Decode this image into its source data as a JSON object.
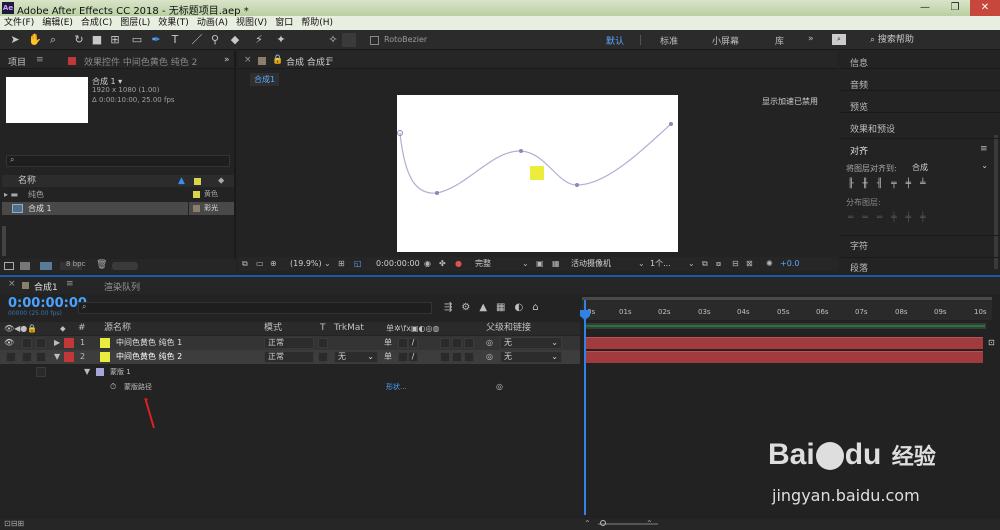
{
  "window": {
    "title": "Adobe After Effects CC 2018 - 无标题项目.aep *",
    "logo": "Ae"
  },
  "menu": [
    "文件(F)",
    "编辑(E)",
    "合成(C)",
    "图层(L)",
    "效果(T)",
    "动画(A)",
    "视图(V)",
    "窗口",
    "帮助(H)"
  ],
  "toolbar": {
    "rotobezier": "RotoBezier",
    "workspaces": [
      "默认",
      "标准",
      "小屏幕",
      "库"
    ],
    "search_placeholder": "搜索帮助"
  },
  "project": {
    "tab_label": "项目",
    "effects_tab": "效果控件 中间色黄色 纯色 2",
    "comp_name": "合成 1 ▾",
    "comp_res": "1920 x 1080 (1.00)",
    "comp_duration": "Δ 0:00:10:00, 25.00 fps",
    "col_name": "名称",
    "items": [
      {
        "name": "纯色",
        "type": "黄色"
      },
      {
        "name": "合成 1",
        "type": "彩光"
      }
    ],
    "bpc": "8 bpc"
  },
  "comp": {
    "tab_label": "合成 合成1",
    "sub_tab": "合成1",
    "gpu_notice": "显示加速已禁用",
    "zoom": "(19.9%)",
    "timecode": "0:00:00:00",
    "quality": "完整",
    "camera": "活动摄像机",
    "views": "1个...",
    "exposure": "+0.0"
  },
  "right_panel": {
    "items": [
      "信息",
      "音频",
      "预览",
      "效果和预设"
    ],
    "align_label": "对齐",
    "align_to_label": "将图层对齐到:",
    "align_to_value": "合成",
    "distribute_label": "分布图层:",
    "bottom_items": [
      "字符",
      "段落"
    ]
  },
  "timeline": {
    "tab_label": "合成1",
    "render_queue": "渲染队列",
    "timecode": "0:00:00:00",
    "fps": "00000 (25.00 fps)",
    "col_source": "源名称",
    "col_mode": "模式",
    "col_t": "T",
    "col_trkmat": "TrkMat",
    "col_parent": "父级和链接",
    "layers": [
      {
        "num": "1",
        "name": "中间色黄色 纯色 1",
        "mode": "正常",
        "trkmat": "",
        "parent": "无",
        "color": "#d8d54a"
      },
      {
        "num": "2",
        "name": "中间色黄色 纯色 2",
        "mode": "正常",
        "trkmat": "无",
        "parent": "无",
        "color": "#d8d54a"
      }
    ],
    "mask_label": "蒙版 1",
    "mask_path_label": "蒙版路径",
    "mask_path_value": "形状...",
    "ruler_ticks": [
      "0s",
      "01s",
      "02s",
      "03s",
      "04s",
      "05s",
      "06s",
      "07s",
      "08s",
      "09s",
      "10s"
    ]
  },
  "watermark": {
    "brand": "Bai",
    "brand2": "du",
    "suffix": "经验",
    "url": "jingyan.baidu.com"
  },
  "colors": {
    "accent": "#4aa3ff",
    "track": "#a13b3e",
    "label_red": "#c23838",
    "solid_yellow": "#ecec3c"
  }
}
